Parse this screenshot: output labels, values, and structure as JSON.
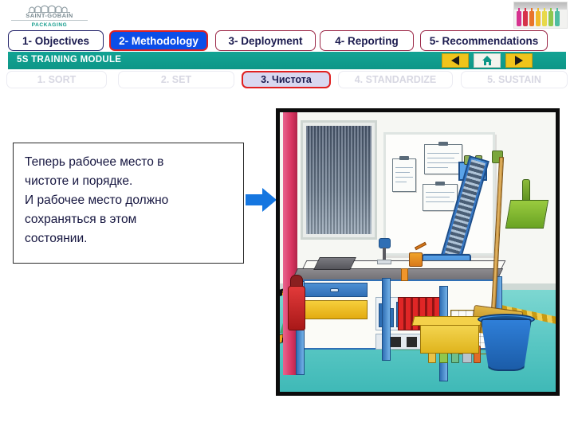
{
  "logo": {
    "brand": "SAINT-GOBAIN",
    "division": "PACKAGING",
    "icon": "aqueduct-bridge-icon"
  },
  "header_image": {
    "name": "colored-bottles-photo",
    "bottle_colors": [
      "#d6338f",
      "#d6334a",
      "#e8742a",
      "#f0bb2a",
      "#e8d94a",
      "#8fc74e",
      "#4fbda0"
    ]
  },
  "tabs": [
    {
      "label": "1- Objectives",
      "state": "inactive"
    },
    {
      "label": "2- Methodology",
      "state": "active"
    },
    {
      "label": "3- Deployment",
      "state": "inactive"
    },
    {
      "label": "4- Reporting",
      "state": "inactive"
    },
    {
      "label": "5- Recommendations",
      "state": "inactive"
    }
  ],
  "module_bar": {
    "title": "5S TRAINING MODULE",
    "background_color": "#0d9687",
    "nav": {
      "back_icon": "triangle-left-icon",
      "home_icon": "home-icon",
      "forward_icon": "triangle-right-icon",
      "button_color": "#f0c41b"
    }
  },
  "steps": [
    {
      "label": "1. SORT",
      "state": "disabled"
    },
    {
      "label": "2. SET",
      "state": "disabled"
    },
    {
      "label": "3. Чистота",
      "state": "current"
    },
    {
      "label": "4. STANDARDIZE",
      "state": "disabled"
    },
    {
      "label": "5. SUSTAIN",
      "state": "disabled"
    }
  ],
  "callout": {
    "line1": "Теперь рабочее место в",
    "line2": "чистоте и порядке.",
    "line3": "И рабочее место должно",
    "line4": "сохраняться в этом",
    "line5": "состоянии."
  },
  "arrow": {
    "name": "right-arrow-icon",
    "color": "#1576e0"
  },
  "illustration": {
    "name": "clean-workshop-workbench-illustration",
    "description": "Cartoon illustration of a tidy workshop: blue workbench with drawers and organized tool shelves, whiteboard with clipboards, conveyor machine, broom and green dustpan on the wall, yellow crate of cleaning bottles, blue bucket, hazard-striped floor marking, fire extinguisher.",
    "accent_colors": {
      "bench": "#2f6fb5",
      "floor": "#58c6c3",
      "floor_zone": "#3f9f64",
      "hazard_stripe": "#f0a81b",
      "bucket": "#1b5ca8",
      "crate": "#dfb41d",
      "dustpan": "#69a323",
      "wall_strip": "#d8335f"
    }
  }
}
